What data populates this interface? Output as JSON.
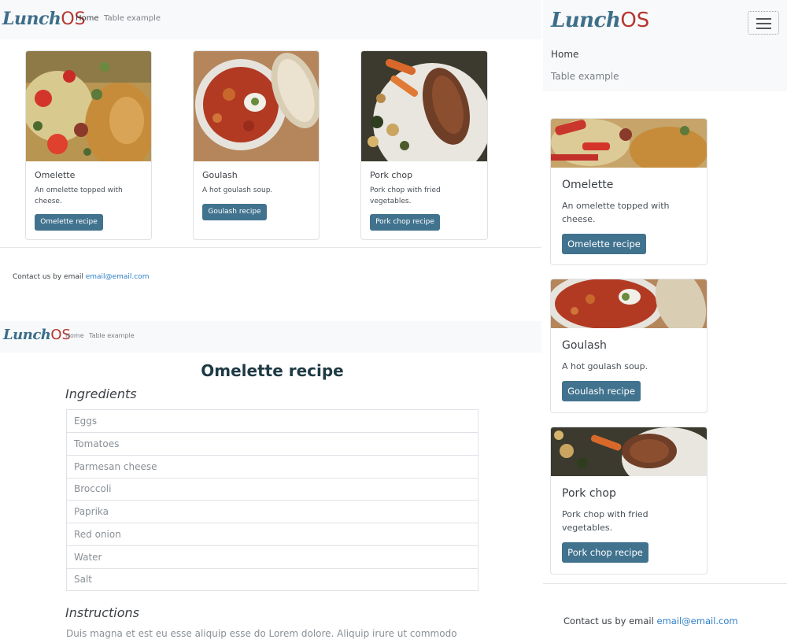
{
  "brand": {
    "script": "Lunch",
    "os": "OS"
  },
  "nav": {
    "home": "Home",
    "table": "Table example"
  },
  "cards": [
    {
      "title": "Omelette",
      "text": "An omelette topped with cheese.",
      "button": "Omelette recipe"
    },
    {
      "title": "Goulash",
      "text": "A hot goulash soup.",
      "button": "Goulash recipe"
    },
    {
      "title": "Pork chop",
      "text": "Pork chop with fried vegetables.",
      "button": "Pork chop recipe"
    }
  ],
  "footer": {
    "text": "Contact us by email",
    "email": "email@email.com"
  },
  "recipe": {
    "title": "Omelette recipe",
    "ingredients_heading": "Ingredients",
    "ingredients": [
      "Eggs",
      "Tomatoes",
      "Parmesan cheese",
      "Broccoli",
      "Paprika",
      "Red onion",
      "Water",
      "Salt"
    ],
    "instructions_heading": "Instructions",
    "instructions_text": "Duis magna et est eu esse aliquip esse do Lorem dolore. Aliquip irure ut commodo"
  },
  "colors": {
    "primary_button": "#41738f",
    "brand_blue": "#3d6e8a",
    "brand_red": "#b5362f",
    "link": "#2f7fc8",
    "navbar_bg": "#f8f9fa"
  }
}
